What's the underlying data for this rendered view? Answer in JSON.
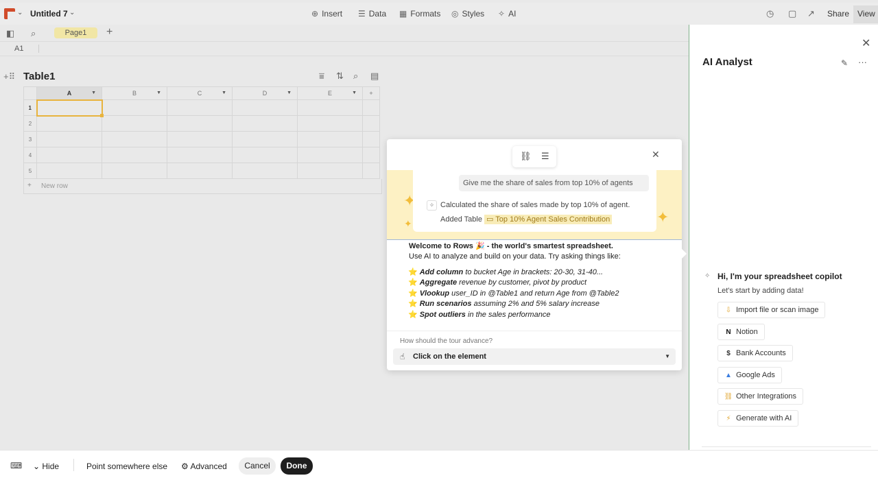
{
  "header": {
    "doc_title": "Untitled 7",
    "menu": [
      "Insert",
      "Data",
      "Formats",
      "Styles",
      "AI"
    ],
    "share": "Share",
    "view": "View"
  },
  "pages": {
    "active": "Page1"
  },
  "cell_ref": "A1",
  "table": {
    "title": "Table1",
    "columns": [
      "A",
      "B",
      "C",
      "D",
      "E"
    ],
    "rows": [
      "1",
      "2",
      "3",
      "4",
      "5"
    ],
    "new_row": "New row"
  },
  "tour_popup": {
    "chat_prompt": "Give me the share of sales from top 10% of agents",
    "chat_result": "Calculated the share of sales made by top 10% of agent.",
    "added_prefix": "Added Table",
    "added_table": "Top 10% Agent Sales Contribution",
    "welcome_title": "Welcome to Rows 🎉 - the world's smartest spreadsheet.",
    "welcome_sub": "Use AI to analyze and build on your data. Try asking things like:",
    "examples": [
      {
        "bold": "Add column",
        "rest": " to bucket Age in brackets: 20-30, 31-40..."
      },
      {
        "bold": "Aggregate",
        "rest": " revenue by customer, pivot by product"
      },
      {
        "bold": "Vlookup",
        "rest": " user_ID in @Table1 and return Age from @Table2"
      },
      {
        "bold": "Run scenarios",
        "rest": " assuming 2% and 5% salary increase"
      },
      {
        "bold": "Spot outliers",
        "rest": " in the sales performance"
      }
    ],
    "tour_question": "How should the tour advance?",
    "tour_option": "Click on the element"
  },
  "panel": {
    "title": "AI Analyst",
    "copilot_heading": "Hi, I'm your spreadsheet copilot",
    "copilot_sub": "Let's start by adding data!",
    "options": [
      {
        "label": "Import file or scan image",
        "icon": "import-icon"
      },
      {
        "label": "Notion",
        "icon": "notion-icon"
      },
      {
        "label": "Bank Accounts",
        "icon": "bank-icon"
      },
      {
        "label": "Google Ads",
        "icon": "google-ads-icon"
      },
      {
        "label": "Other Integrations",
        "icon": "integrations-icon"
      },
      {
        "label": "Generate with AI",
        "icon": "wand-icon"
      }
    ]
  },
  "bottom_bar": {
    "hide": "Hide",
    "point": "Point somewhere else",
    "advanced": "Advanced",
    "cancel": "Cancel",
    "done": "Done"
  },
  "colors": {
    "brand": "#d14b2a",
    "selection": "#e8b33d",
    "banner": "#fdf1c4",
    "done_button": "#1e1e1e"
  }
}
